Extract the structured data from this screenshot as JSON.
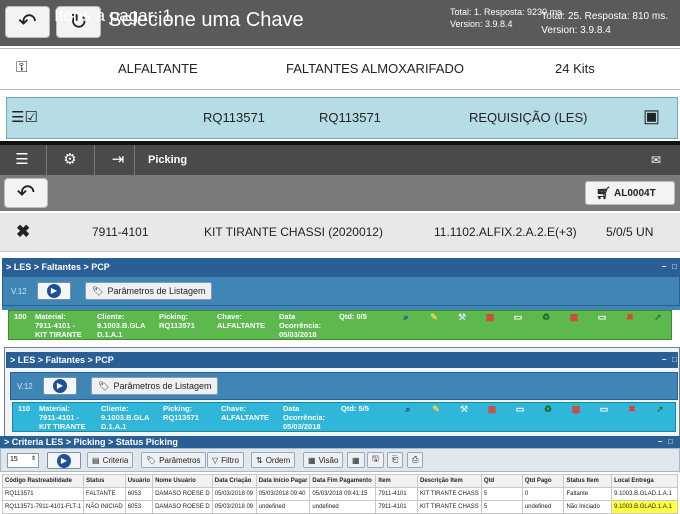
{
  "s1": {
    "title": "Selecione uma Chave",
    "total": "Total: 25. Resposta: 810 ms.",
    "version": "Version: 3.9.8.4",
    "row_a": {
      "c1": "ALFALTANTE",
      "c2": "FALTANTES ALMOXARIFADO",
      "c3": "24 Kits"
    },
    "row_b": {
      "c1": "RQ113571",
      "c2": "RQ113571",
      "c3": "REQUISIÇÃO (LES)"
    }
  },
  "s2": {
    "menu_label": "Picking",
    "title": "Itens a pagar: 1",
    "total": "Total: 1. Resposta: 9230 ms.",
    "version": "Version: 3.9.8.4",
    "al_button": "AL0004T",
    "row": {
      "c1": "7911-4101",
      "c2": "KIT TIRANTE CHASSI (2020012)",
      "c3": "11.1102.ALFIX.2.A.2.E(+3)",
      "c4": "5/0/5 UN"
    }
  },
  "p1": {
    "breadcrumb": "> LES > Faltantes > PCP",
    "version": "V.12",
    "params_btn": "Parâmetros de Listagem",
    "row": {
      "num": "100",
      "mat_l": "Material:",
      "mat_v1": "7911-4101 -",
      "mat_v2": "KIT TIRANTE",
      "cli_l": "Cliente:",
      "cli_v1": "9.1003.B.GLA",
      "cli_v2": "D.1.A.1",
      "pick_l": "Picking:",
      "pick_v": "RQ113571",
      "ch_l": "Chave:",
      "ch_v": "ALFALTANTE",
      "dt_l1": "Data",
      "dt_l2": "Ocorrência:",
      "dt_v": "05/03/2018",
      "qtd": "Qtd: 0/5"
    }
  },
  "p2": {
    "breadcrumb": "> LES > Faltantes > PCP",
    "version": "V.12",
    "params_btn": "Parâmetros de Listagem",
    "row": {
      "num": "110",
      "mat_l": "Material:",
      "mat_v1": "7911-4101 -",
      "mat_v2": "KIT TIRANTE",
      "cli_l": "Cliente:",
      "cli_v1": "9.1003.B.GLA",
      "cli_v2": "D.1.A.1",
      "pick_l": "Picking:",
      "pick_v": "RQ113571",
      "ch_l": "Chave:",
      "ch_v": "ALFALTANTE",
      "dt_l1": "Data",
      "dt_l2": "Ocorrência:",
      "dt_v": "05/03/2018",
      "qtd": "Qtd: 5/5"
    }
  },
  "p3": {
    "breadcrumb": "> Criteria LES > Picking > Status Picking",
    "page_size": "15",
    "buttons": {
      "criteria": "Criteria",
      "params": "Parâmetros",
      "filter": "Filtro",
      "order": "Ordem",
      "view": "Visão"
    },
    "headers": [
      "Código Rastreabilidade",
      "Status",
      "Usuário",
      "Nome Usuário",
      "Data Criação",
      "Data Início Pagar",
      "Data Fim Pagamento",
      "Item",
      "Descrição Item",
      "Qtd",
      "Qtd Pago",
      "Status Item",
      "Local Entrega"
    ],
    "rows": [
      [
        "RQ113571",
        "FALTANTE",
        "6053",
        "DAMASO ROESE D",
        "05/03/2018 09",
        "05/03/2018 09:40",
        "05/03/2018 09:41:15",
        "7911-4101",
        "KIT TIRANTE CHASS",
        "5",
        "0",
        "Faltante",
        "9.1003.B.GLAD.1.A.1"
      ],
      [
        "RQ113571-7911-4101-FLT-1",
        "NÃO INICIAD",
        "6053",
        "DAMASO ROESE D",
        "05/03/2018 09",
        "undefined",
        "undefined",
        "7911-4101",
        "KIT TIRANTE CHASS",
        "5",
        "undefined",
        "Não Iniciado",
        "9.1003.B.GLAD.1.A.1"
      ]
    ]
  }
}
